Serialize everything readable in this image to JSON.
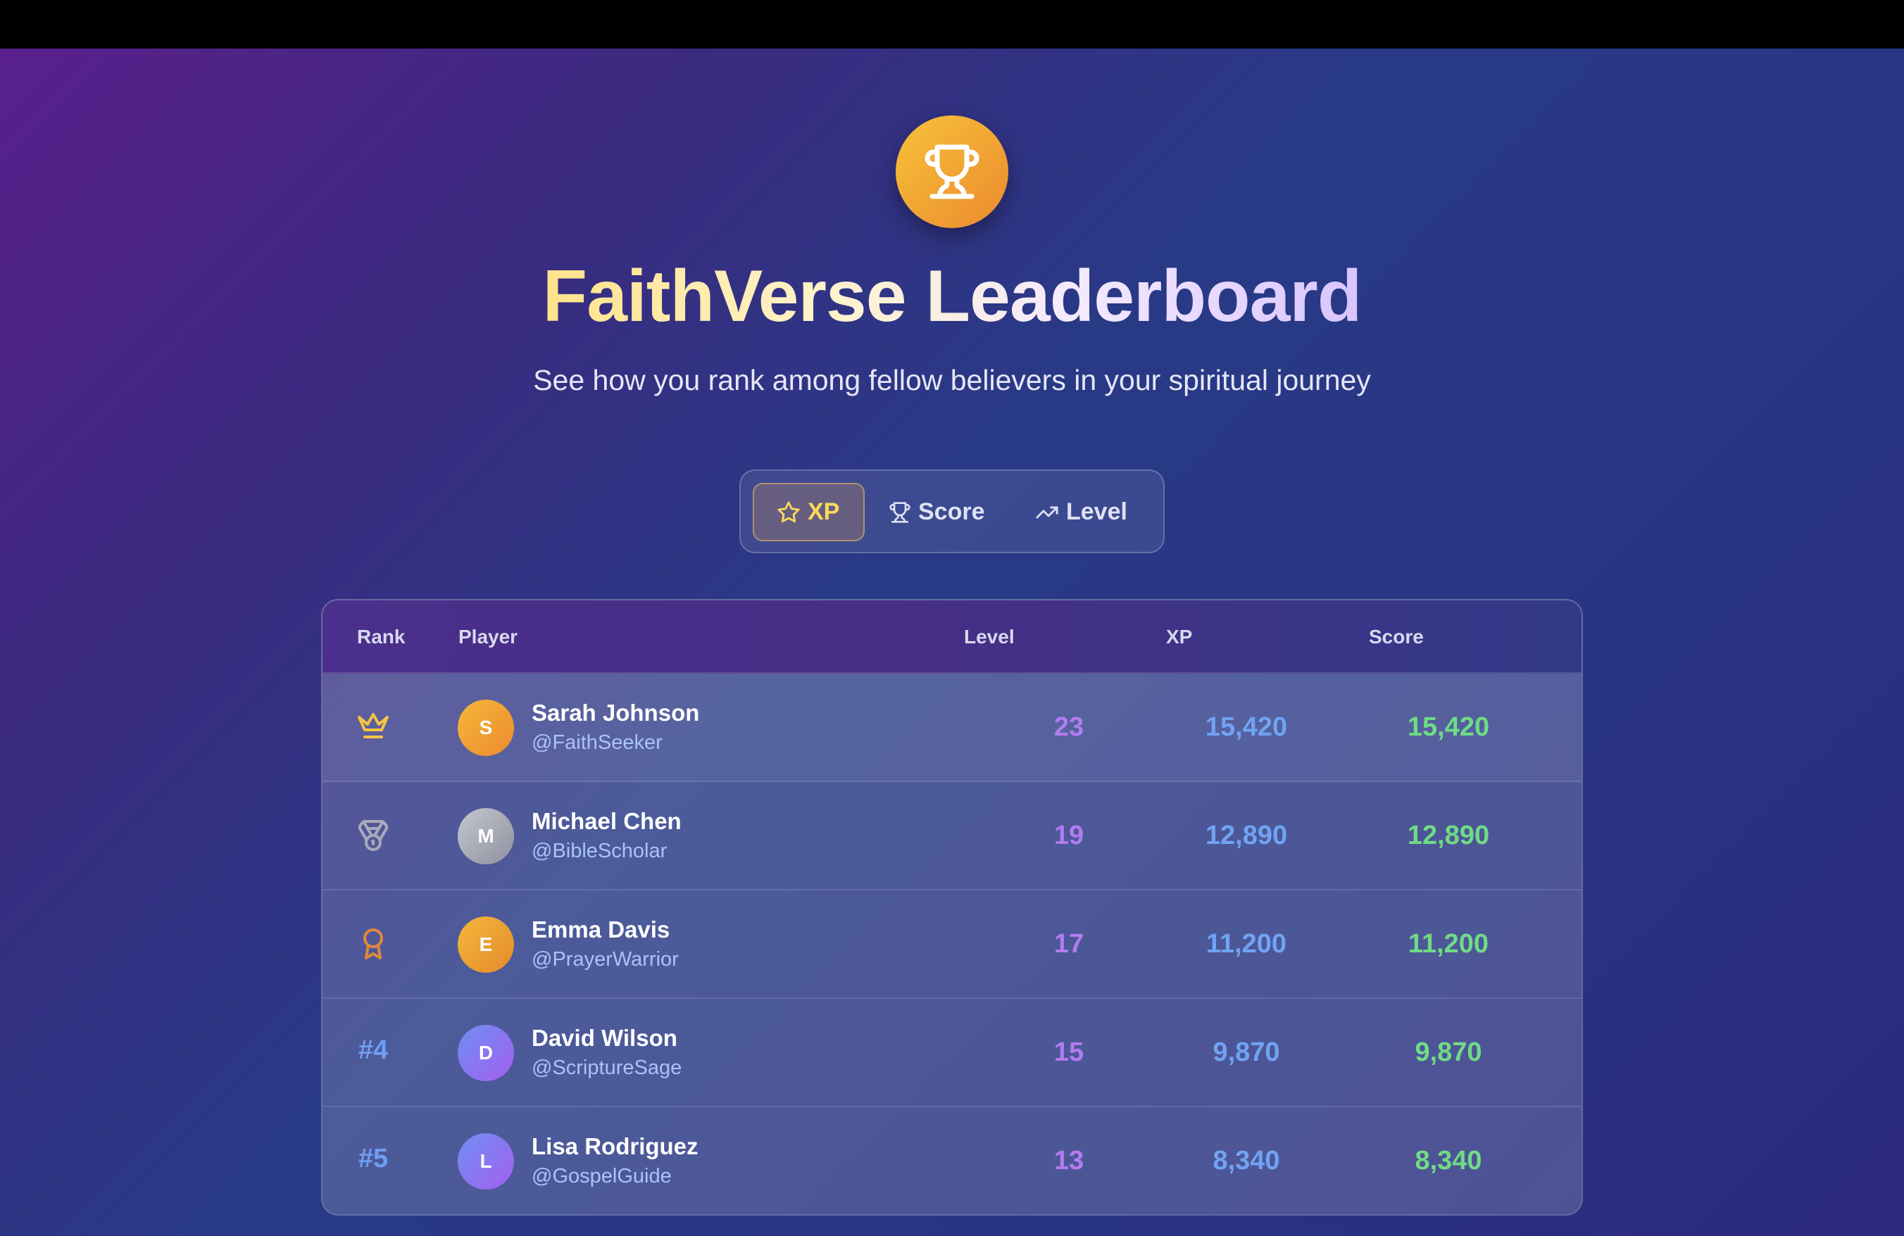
{
  "header": {
    "title": "FaithVerse Leaderboard",
    "subtitle": "See how you rank among fellow believers in your spiritual journey"
  },
  "tabs": [
    {
      "label": "XP",
      "icon": "star-icon",
      "active": true
    },
    {
      "label": "Score",
      "icon": "trophy-icon",
      "active": false
    },
    {
      "label": "Level",
      "icon": "trending-up-icon",
      "active": false
    }
  ],
  "table": {
    "columns": [
      "Rank",
      "Player",
      "Level",
      "XP",
      "Score"
    ],
    "rows": [
      {
        "rank": "1",
        "rank_icon": "crown-icon",
        "initial": "S",
        "name": "Sarah Johnson",
        "handle": "@FaithSeeker",
        "level": "23",
        "xp": "15,420",
        "score": "15,420"
      },
      {
        "rank": "2",
        "rank_icon": "medal-icon",
        "initial": "M",
        "name": "Michael Chen",
        "handle": "@BibleScholar",
        "level": "19",
        "xp": "12,890",
        "score": "12,890"
      },
      {
        "rank": "3",
        "rank_icon": "award-icon",
        "initial": "E",
        "name": "Emma Davis",
        "handle": "@PrayerWarrior",
        "level": "17",
        "xp": "11,200",
        "score": "11,200"
      },
      {
        "rank": "#4",
        "rank_icon": "",
        "initial": "D",
        "name": "David Wilson",
        "handle": "@ScriptureSage",
        "level": "15",
        "xp": "9,870",
        "score": "9,870"
      },
      {
        "rank": "#5",
        "rank_icon": "",
        "initial": "L",
        "name": "Lisa Rodriguez",
        "handle": "@GospelGuide",
        "level": "13",
        "xp": "8,340",
        "score": "8,340"
      }
    ]
  },
  "colors": {
    "gold": "#f5b93a",
    "silver": "#a8abb8",
    "bronze": "#e2893a",
    "level": "#b27cf0",
    "xp": "#71a3f3",
    "score": "#6fdb86"
  }
}
